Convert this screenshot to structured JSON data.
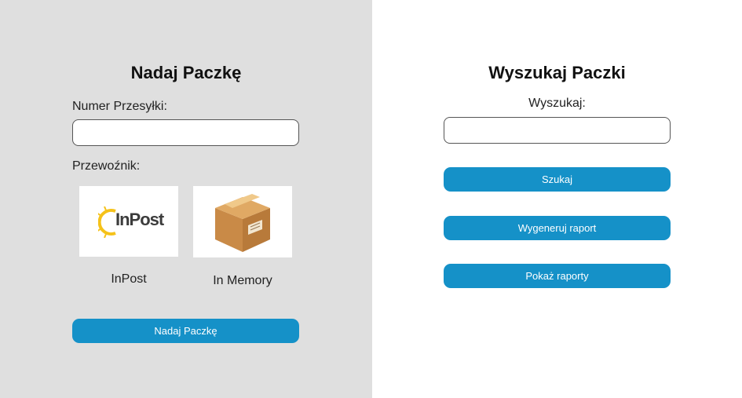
{
  "send_section": {
    "title": "Nadaj Paczkę",
    "tracking_label": "Numer Przesyłki:",
    "tracking_value": "",
    "carrier_label": "Przewoźnik:",
    "carriers": [
      {
        "name": "InPost",
        "logo_text": "InPost",
        "icon": "inpost-logo"
      },
      {
        "name": "In Memory",
        "icon": "package-box-icon"
      }
    ],
    "submit_label": "Nadaj Paczkę"
  },
  "search_section": {
    "title": "Wyszukaj Paczki",
    "search_label": "Wyszukaj:",
    "search_value": "",
    "search_button": "Szukaj",
    "generate_report_button": "Wygeneruj raport",
    "show_reports_button": "Pokaż raporty"
  },
  "colors": {
    "left_background": "#dfdfdf",
    "right_background": "#ffffff",
    "button": "#1591c8",
    "inpost_yellow": "#f5c21a",
    "box_brown": "#c98a47"
  }
}
